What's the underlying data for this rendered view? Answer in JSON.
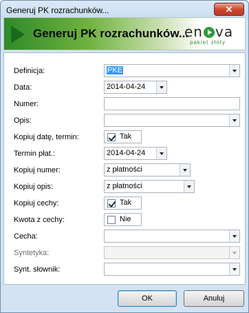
{
  "window": {
    "title": "Generuj PK rozrachunków...",
    "close_glyph": "✕"
  },
  "banner": {
    "title": "Generuj PK rozrachunków...",
    "logo_word_start": "en",
    "logo_word_end": "va",
    "logo_sub": "pakiet złoty",
    "icon": "green-arrow-icon"
  },
  "form": {
    "definicja": {
      "label": "Definicja:",
      "value": "PKE"
    },
    "data": {
      "label": "Data:",
      "value": "2014-04-24"
    },
    "numer": {
      "label": "Numer:",
      "value": ""
    },
    "opis": {
      "label": "Opis:",
      "value": ""
    },
    "kopiuj_date": {
      "label": "Kopiuj datę, termin:",
      "checked": true,
      "text": "Tak"
    },
    "termin": {
      "label": "Termin płat.:",
      "value": "2014-04-24"
    },
    "kopiuj_numer": {
      "label": "Kopiuj numer:",
      "value": "z płatności"
    },
    "kopiuj_opis": {
      "label": "Kopiuj opis:",
      "value": "z płatności"
    },
    "kopiuj_cechy": {
      "label": "Kopiuj cechy:",
      "checked": true,
      "text": "Tak"
    },
    "kwota_z_cechy": {
      "label": "Kwota z cechy:",
      "checked": false,
      "text": "Nie"
    },
    "cecha": {
      "label": "Cecha:",
      "value": ""
    },
    "syntetyka": {
      "label": "Syntetyka:",
      "value": ""
    },
    "synt_slownik": {
      "label": "Synt. słownik:",
      "value": ""
    }
  },
  "buttons": {
    "ok": "OK",
    "cancel": "Anuluj"
  }
}
